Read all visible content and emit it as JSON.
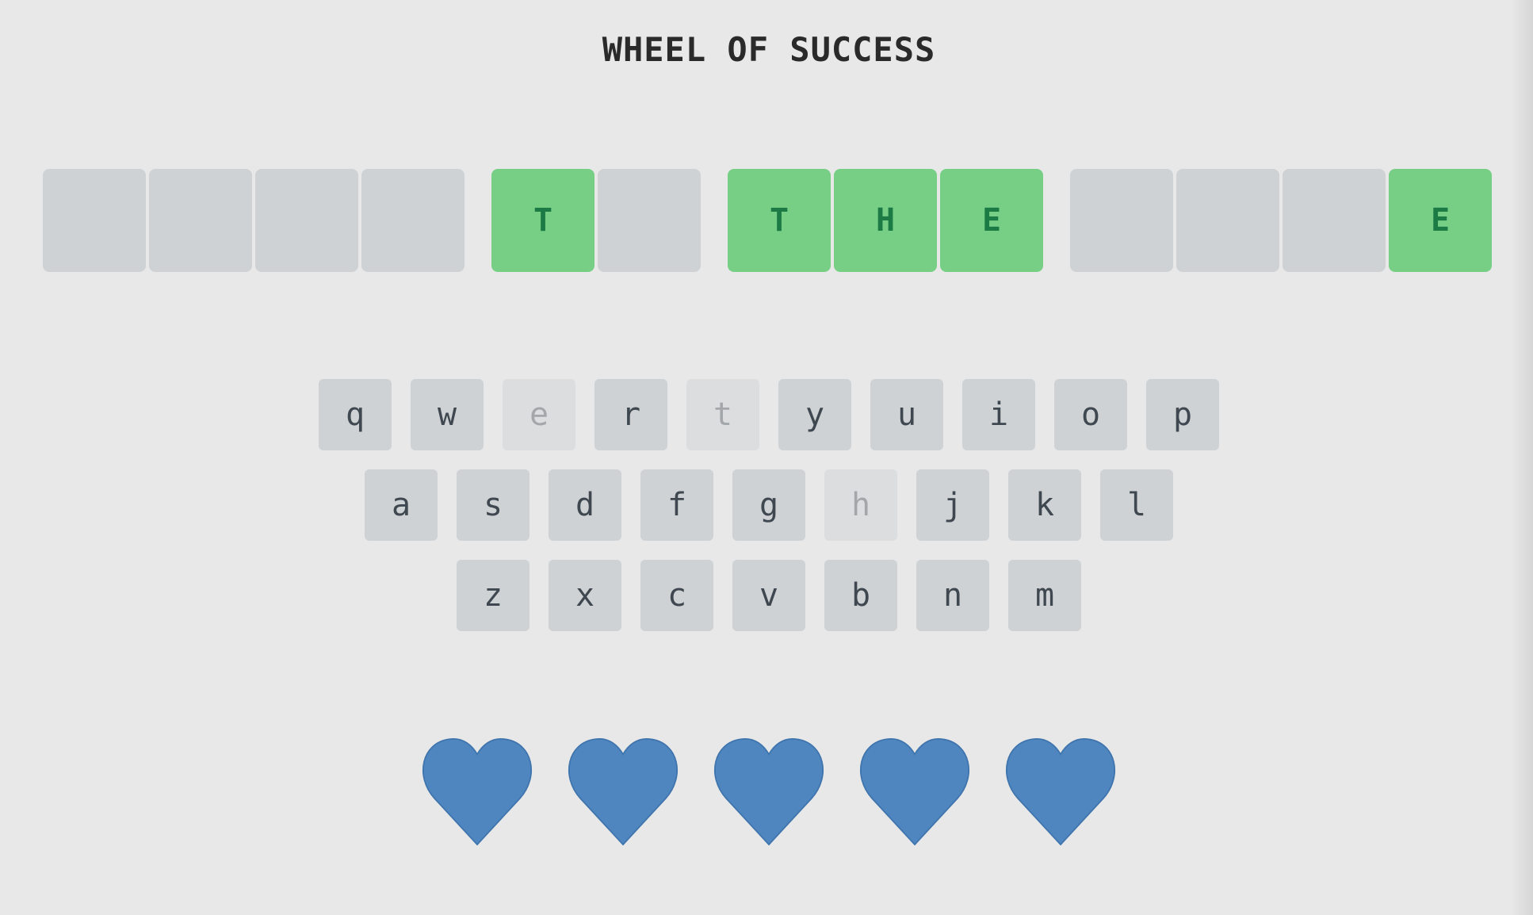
{
  "title": "WHEEL OF SUCCESS",
  "puzzle": {
    "words": [
      [
        "",
        "",
        "",
        ""
      ],
      [
        "T",
        ""
      ],
      [
        "T",
        "H",
        "E"
      ],
      [
        "",
        "",
        "",
        "E"
      ]
    ]
  },
  "keyboard": {
    "rows": [
      [
        {
          "letter": "q",
          "used": false
        },
        {
          "letter": "w",
          "used": false
        },
        {
          "letter": "e",
          "used": true
        },
        {
          "letter": "r",
          "used": false
        },
        {
          "letter": "t",
          "used": true
        },
        {
          "letter": "y",
          "used": false
        },
        {
          "letter": "u",
          "used": false
        },
        {
          "letter": "i",
          "used": false
        },
        {
          "letter": "o",
          "used": false
        },
        {
          "letter": "p",
          "used": false
        }
      ],
      [
        {
          "letter": "a",
          "used": false
        },
        {
          "letter": "s",
          "used": false
        },
        {
          "letter": "d",
          "used": false
        },
        {
          "letter": "f",
          "used": false
        },
        {
          "letter": "g",
          "used": false
        },
        {
          "letter": "h",
          "used": true
        },
        {
          "letter": "j",
          "used": false
        },
        {
          "letter": "k",
          "used": false
        },
        {
          "letter": "l",
          "used": false
        }
      ],
      [
        {
          "letter": "z",
          "used": false
        },
        {
          "letter": "x",
          "used": false
        },
        {
          "letter": "c",
          "used": false
        },
        {
          "letter": "v",
          "used": false
        },
        {
          "letter": "b",
          "used": false
        },
        {
          "letter": "n",
          "used": false
        },
        {
          "letter": "m",
          "used": false
        }
      ]
    ]
  },
  "lives": {
    "remaining": 5,
    "icon": "heart-icon",
    "color": "#4f86bf"
  },
  "colors": {
    "revealed_tile": "#77cf86",
    "revealed_text": "#1c7a44",
    "hidden_tile": "#cfd2d4"
  }
}
